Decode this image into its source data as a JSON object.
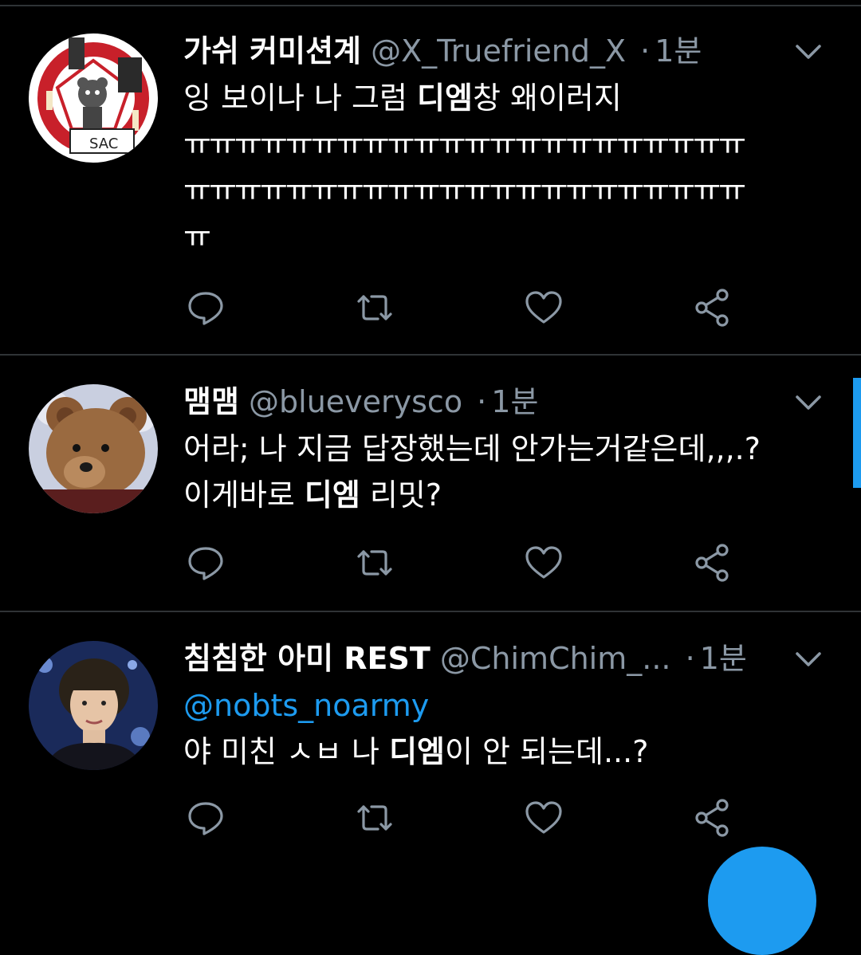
{
  "colors": {
    "background": "#000000",
    "divider": "#2f3336",
    "secondary_text": "#8b98a5",
    "accent": "#1d9bf0"
  },
  "tweets": [
    {
      "display_name": "가쉬 커미션계",
      "handle": "@X_Truefriend_X",
      "separator": "·",
      "time": "1분",
      "text_line1_pre": "잉 보이나 나 그럼 ",
      "text_line1_bold": "디엠",
      "text_line1_post": "창 왜이러지",
      "text_line2": "ㅠㅠㅠㅠㅠㅠㅠㅠㅠㅠㅠㅠㅠㅠㅠㅠㅠㅠㅠㅠㅠㅠ",
      "text_line3": "ㅠㅠㅠㅠㅠㅠㅠㅠㅠㅠㅠㅠㅠㅠㅠㅠㅠㅠㅠㅠㅠㅠ",
      "text_line4": "ㅠ",
      "avatar_icon": "bear-pentagram-avatar-icon"
    },
    {
      "display_name": "맴맴",
      "handle": "@blueverysco",
      "separator": "·",
      "time": "1분",
      "text_line1": "어라; 나 지금 답장했는데 안가는거같은데,,,.?",
      "text_line2_pre": "이게바로 ",
      "text_line2_bold": "디엠",
      "text_line2_post": " 리밋?",
      "avatar_icon": "teddy-bear-avatar-icon"
    },
    {
      "display_name": "침침한 아미 REST",
      "handle": "@ChimChim_...",
      "separator": "·",
      "time": "1분",
      "mention": "@nobts_noarmy",
      "text_line2_pre": "야 미친 ㅅㅂ 나 ",
      "text_line2_bold": "디엠",
      "text_line2_post": "이 안 되는데...?",
      "avatar_icon": "person-portrait-avatar-icon"
    }
  ],
  "action_icons": [
    "reply-icon",
    "retweet-icon",
    "like-icon",
    "share-icon"
  ]
}
